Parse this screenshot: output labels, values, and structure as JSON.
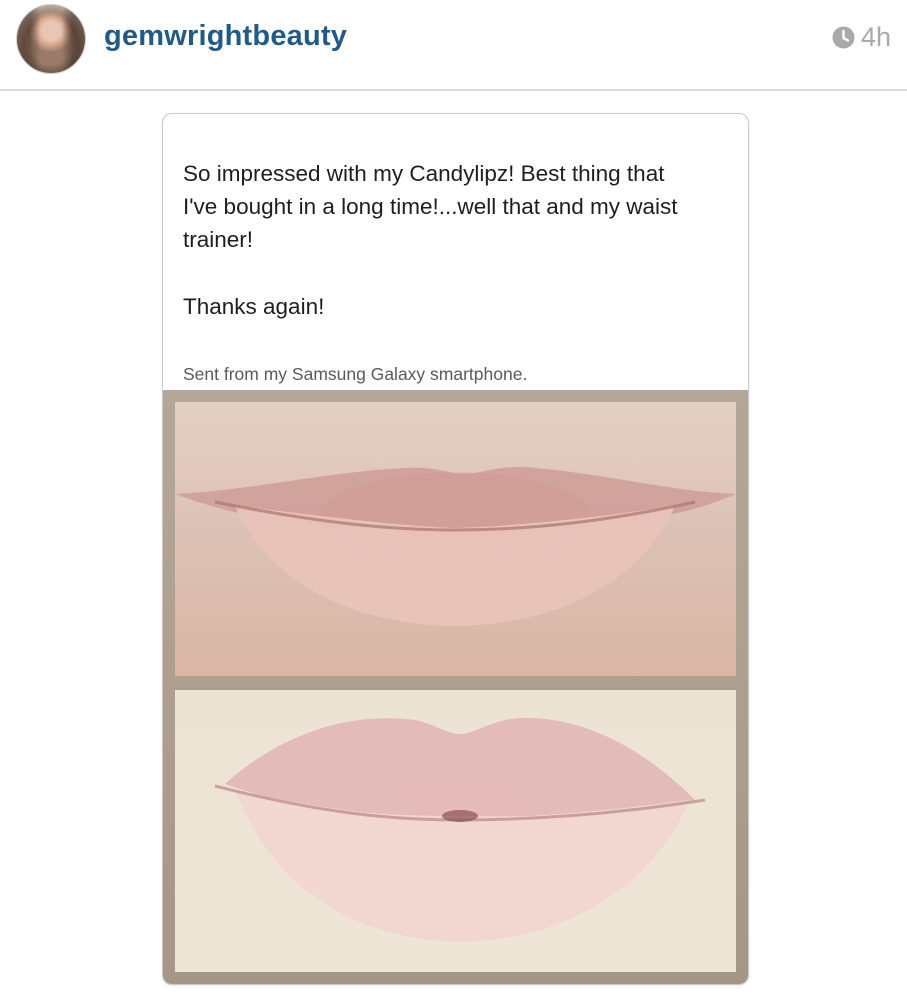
{
  "header": {
    "username": "gemwrightbeauty",
    "timestamp": "4h",
    "avatar_icon": "avatar",
    "clock_icon": "clock-icon"
  },
  "post": {
    "message_lines": [
      "So impressed with my Candylipz! Best thing that",
      "I've bought in a long time!...well that and my waist",
      "trainer!"
    ],
    "thanks": "Thanks again!",
    "signature": "Sent from my Samsung Galaxy smartphone."
  },
  "colors": {
    "username": "#225a87",
    "timestamp": "#a9a9a9",
    "divider": "#dadada"
  }
}
